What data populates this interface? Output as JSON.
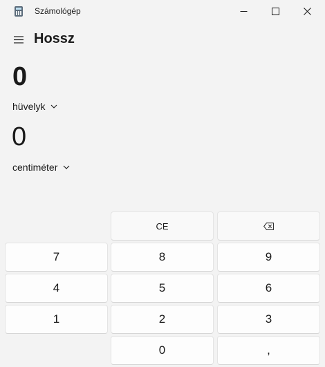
{
  "window": {
    "title": "Számológép",
    "icons": {
      "app": "calculator-icon",
      "minimize": "minimize-icon",
      "maximize": "maximize-icon",
      "close": "close-icon"
    }
  },
  "header": {
    "menu_icon": "hamburger-menu-icon",
    "mode_title": "Hossz"
  },
  "converter": {
    "from": {
      "value": "0",
      "unit": "hüvelyk"
    },
    "to": {
      "value": "0",
      "unit": "centiméter"
    }
  },
  "keypad": {
    "ce": "CE",
    "backspace_icon": "backspace-icon",
    "digits": {
      "d7": "7",
      "d8": "8",
      "d9": "9",
      "d4": "4",
      "d5": "5",
      "d6": "6",
      "d1": "1",
      "d2": "2",
      "d3": "3",
      "d0": "0"
    },
    "decimal": ","
  }
}
